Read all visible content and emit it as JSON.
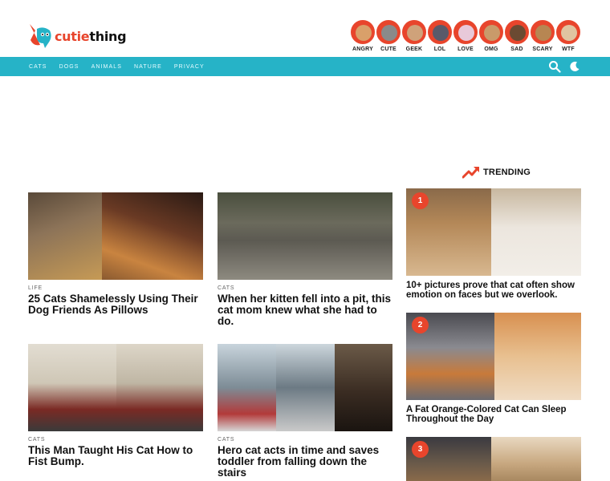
{
  "brand": {
    "name_prefix": "cutie",
    "name_suffix": "thing",
    "accent": "#e8452c",
    "nav_color": "#26b3c7"
  },
  "moods": [
    {
      "label": "ANGRY",
      "icon": "angry-cat-icon"
    },
    {
      "label": "CUTE",
      "icon": "cute-cat-icon"
    },
    {
      "label": "GEEK",
      "icon": "geek-cat-icon"
    },
    {
      "label": "LOL",
      "icon": "lol-dog-icon"
    },
    {
      "label": "LOVE",
      "icon": "love-cat-icon"
    },
    {
      "label": "OMG",
      "icon": "omg-dog-icon"
    },
    {
      "label": "SAD",
      "icon": "sad-dog-icon"
    },
    {
      "label": "SCARY",
      "icon": "scary-dog-icon"
    },
    {
      "label": "WTF",
      "icon": "wtf-dog-icon"
    }
  ],
  "nav": {
    "items": [
      "CATS",
      "DOGS",
      "ANIMALS",
      "NATURE",
      "PRIVACY"
    ],
    "search_icon": "search-icon",
    "theme_icon": "moon-icon"
  },
  "articles": [
    {
      "category": "LIFE",
      "title": "25 Cats Shamelessly Using Their Dog Friends As Pillows"
    },
    {
      "category": "CATS",
      "title": "When her kitten fell into a pit, this cat mom knew what she had to do."
    },
    {
      "category": "CATS",
      "title": "This Man Taught His Cat How to Fist Bump."
    },
    {
      "category": "CATS",
      "title": "Hero cat acts in time and saves toddler from falling down the stairs"
    }
  ],
  "trending": {
    "label": "TRENDING",
    "icon": "trending-arrow-icon",
    "items": [
      {
        "rank": "1",
        "title": "10+ pictures prove that cat often show emotion on faces but we overlook."
      },
      {
        "rank": "2",
        "title": "A Fat Orange-Colored Cat Can Sleep Throughout the Day"
      },
      {
        "rank": "3",
        "title": ""
      }
    ]
  }
}
